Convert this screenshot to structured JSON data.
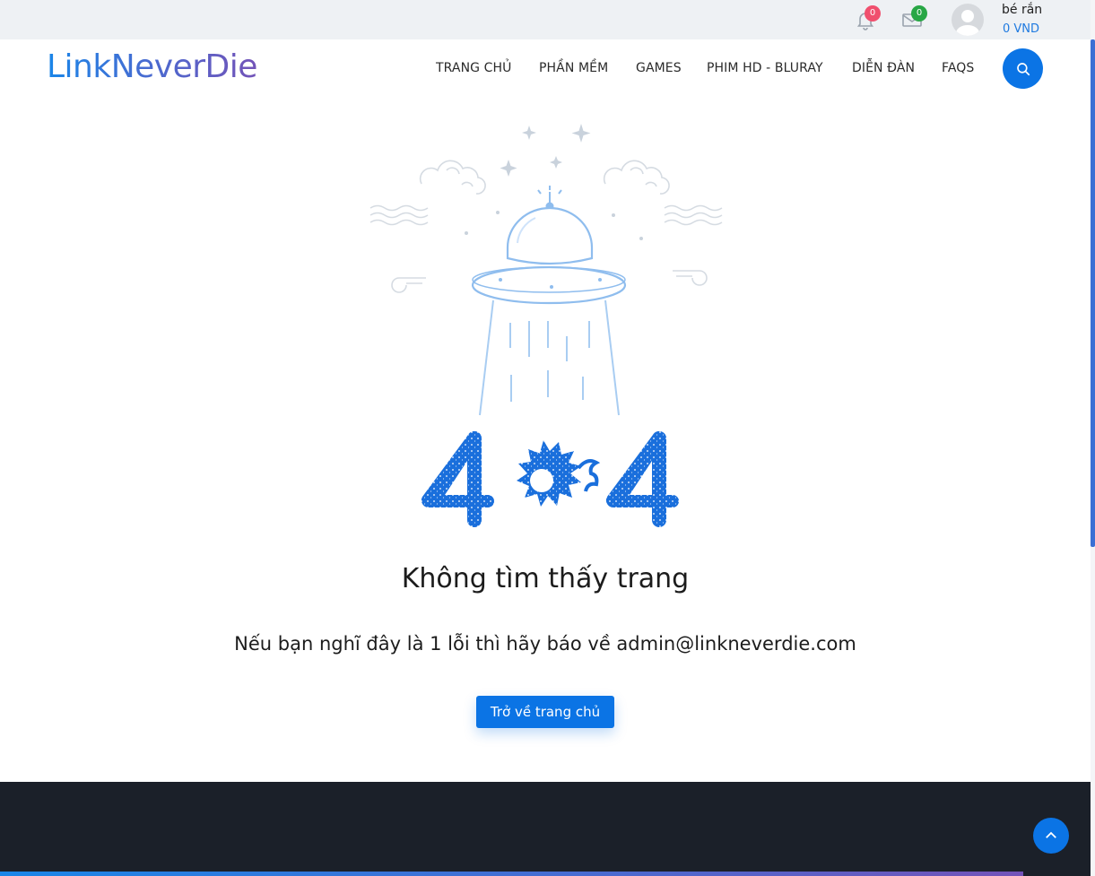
{
  "topbar": {
    "notifications": {
      "count": "0",
      "badge_color": "#f0506e"
    },
    "messages": {
      "count": "0",
      "badge_color": "#28a745"
    },
    "user": {
      "name": "bé rắn",
      "balance": "0 VND"
    }
  },
  "header": {
    "logo": "LinkNeverDie",
    "nav": [
      {
        "label": "TRANG CHỦ"
      },
      {
        "label": "PHẦN MỀM"
      },
      {
        "label": "GAMES"
      },
      {
        "label": "PHIM HD - BLURAY"
      },
      {
        "label": "DIỄN ĐÀN"
      },
      {
        "label": "FAQS"
      }
    ],
    "search_icon": "search-icon"
  },
  "error": {
    "code": "404",
    "title": "Không tìm thấy trang",
    "message": "Nếu bạn nghĩ đây là 1 lỗi thì hãy báo về admin@linkneverdie.com",
    "button": "Trở về trang chủ"
  },
  "colors": {
    "accent": "#0b74e5",
    "footer": "#1b2029",
    "illustration_line": "#a9cdf2",
    "illustration_fill": "#1a6fdc"
  },
  "icons": {
    "bell": "bell-icon",
    "mail": "mail-icon",
    "back_to_top": "chevron-up-icon"
  }
}
